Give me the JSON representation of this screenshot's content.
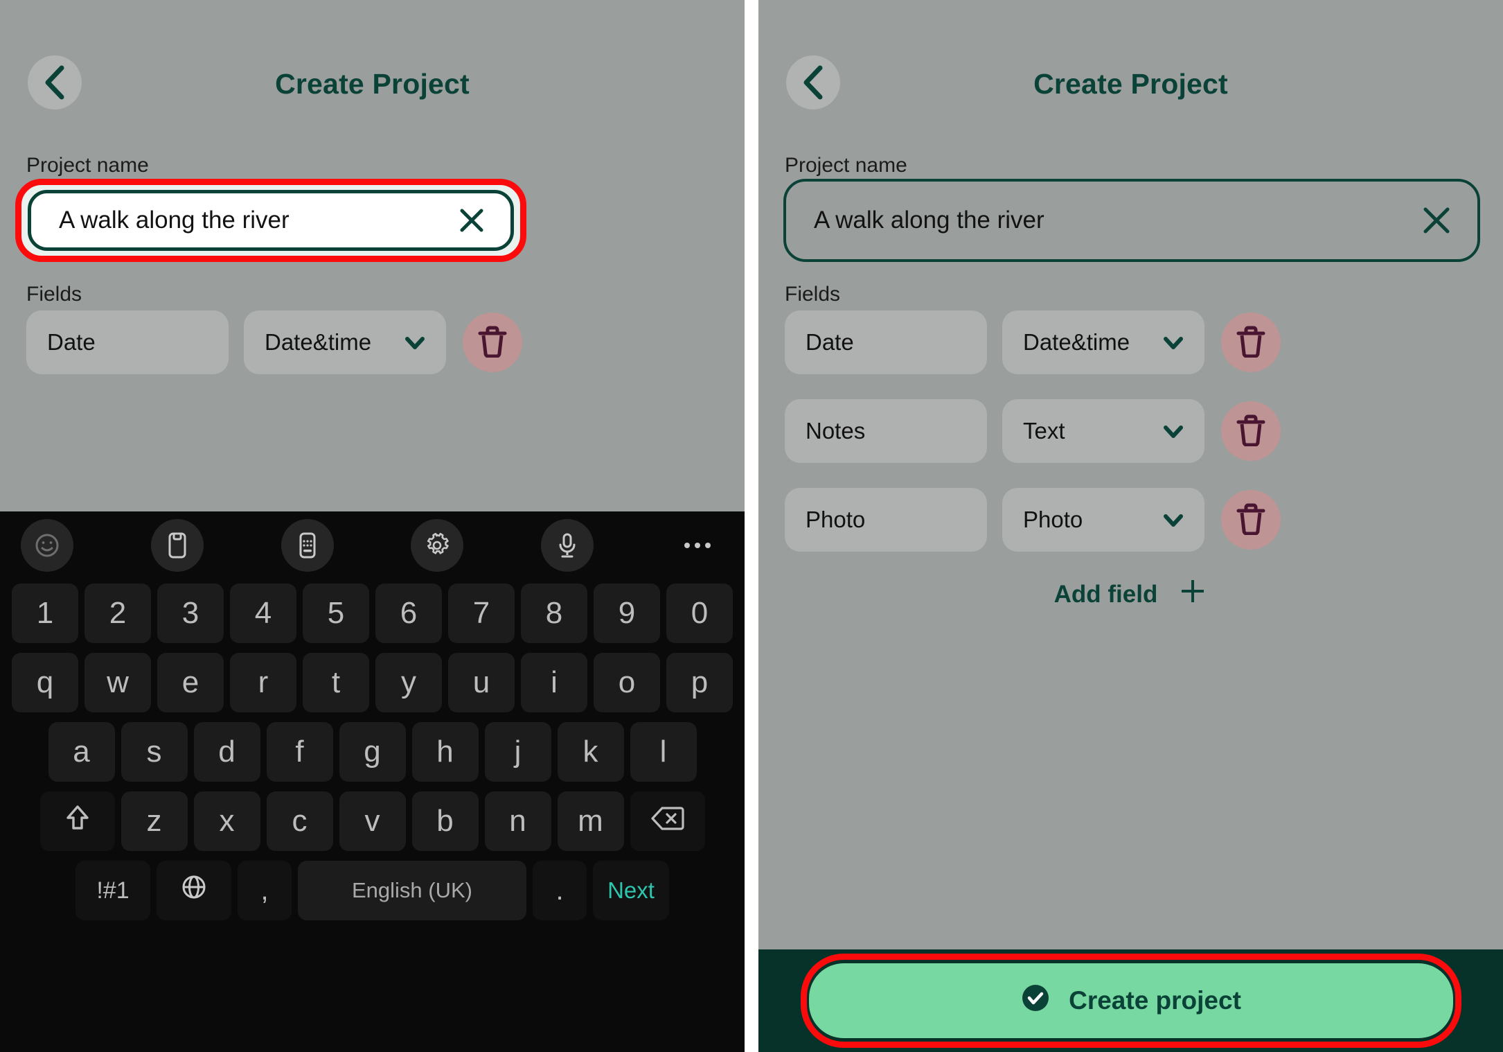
{
  "app": {
    "title": "Create Project",
    "back_icon": "chevron-left-icon"
  },
  "labels": {
    "project_name": "Project name",
    "fields": "Fields"
  },
  "project_name_input": {
    "value": "A walk along the river",
    "placeholder": "Project name",
    "clear_icon": "close-x-icon"
  },
  "fields": {
    "rows": [
      {
        "name": "Date",
        "type": "Date&time",
        "delete_icon": "trash-icon",
        "chevron": "chevron-down-icon"
      },
      {
        "name": "Notes",
        "type": "Text",
        "delete_icon": "trash-icon",
        "chevron": "chevron-down-icon"
      },
      {
        "name": "Photo",
        "type": "Photo",
        "delete_icon": "trash-icon",
        "chevron": "chevron-down-icon"
      }
    ],
    "add_field_label": "Add field",
    "add_field_icon": "plus-icon"
  },
  "cta": {
    "label": "Create project",
    "icon": "check-circle-icon"
  },
  "keyboard": {
    "toolbar": [
      "emoji-smiley-icon",
      "clipboard-icon",
      "sticker-keypad-icon",
      "gear-icon",
      "microphone-icon",
      "more-dots-icon"
    ],
    "row_numbers": [
      "1",
      "2",
      "3",
      "4",
      "5",
      "6",
      "7",
      "8",
      "9",
      "0"
    ],
    "row_top": [
      "q",
      "w",
      "e",
      "r",
      "t",
      "y",
      "u",
      "i",
      "o",
      "p"
    ],
    "row_home": [
      "a",
      "s",
      "d",
      "f",
      "g",
      "h",
      "j",
      "k",
      "l"
    ],
    "row_bottom": [
      "z",
      "x",
      "c",
      "v",
      "b",
      "n",
      "m"
    ],
    "shift_icon": "shift-arrow-icon",
    "backspace_icon": "backspace-icon",
    "symbols_key": "!#1",
    "globe_icon": "globe-icon",
    "comma_key": ",",
    "space_key": "English (UK)",
    "period_key": ".",
    "enter_key": "Next"
  },
  "colors": {
    "background_gray": "#9a9e9d",
    "brand_dark_green": "#0b4237",
    "cta_mint": "#77d8a1",
    "cta_bar": "#063229",
    "highlight_red": "#fb0b0b",
    "trash_circle": "#bf9494",
    "trash_glyph": "#4a1530",
    "keyboard_bg": "#0a0a0a",
    "key_face": "#1c1c1c",
    "key_text": "#bdbdbd",
    "enter_teal": "#2ec6ad"
  }
}
